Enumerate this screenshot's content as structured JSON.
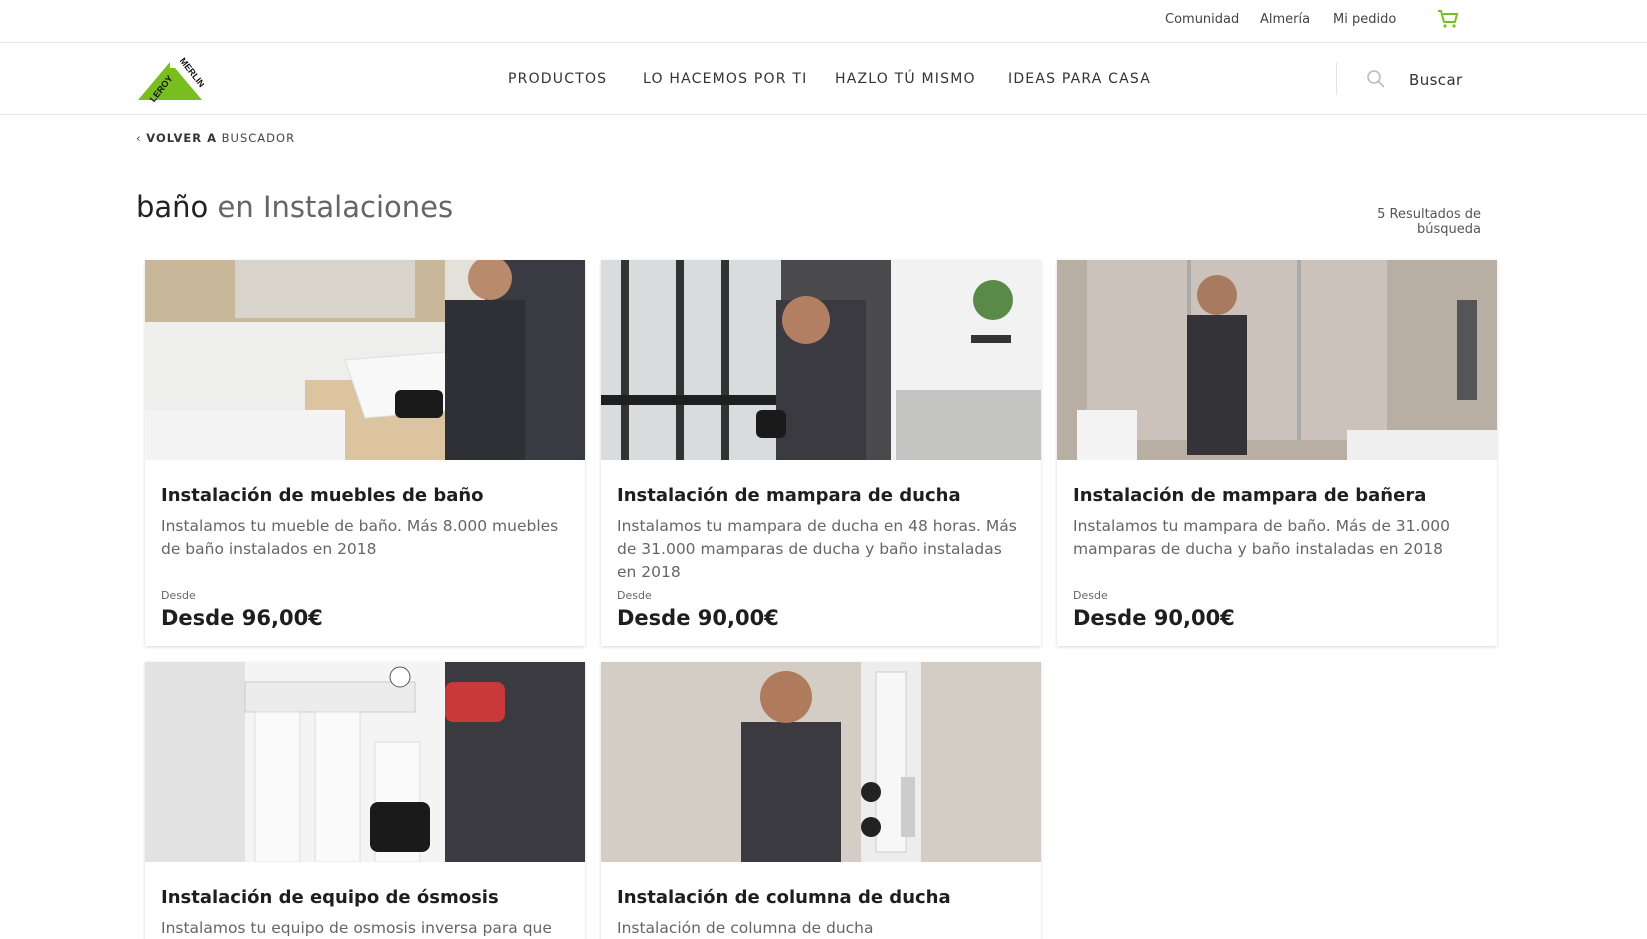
{
  "topbar": {
    "links": [
      "Comunidad",
      "Almería",
      "Mi pedido"
    ]
  },
  "header": {
    "brand": "LEROY MERLIN",
    "nav": [
      "PRODUCTOS",
      "LO HACEMOS POR TI",
      "HAZLO TÚ MISMO",
      "IDEAS PARA CASA"
    ],
    "search_label": "Buscar"
  },
  "back": {
    "bold": "VOLVER A",
    "rest": "BUSCADOR"
  },
  "heading": {
    "query": "baño",
    "connector": "en",
    "category": "Instalaciones"
  },
  "results_count": "5 Resultados de búsqueda",
  "cards": [
    {
      "title": "Instalación de muebles de baño",
      "description": "Instalamos tu mueble de baño. Más 8.000 muebles de baño instalados en 2018",
      "price_label": "Desde",
      "price": "Desde 96,00€"
    },
    {
      "title": "Instalación de mampara de ducha",
      "description": "Instalamos tu mampara de ducha en 48 horas. Más de 31.000 mamparas de ducha y baño instaladas en 2018",
      "price_label": "Desde",
      "price": "Desde 90,00€"
    },
    {
      "title": "Instalación de mampara de bañera",
      "description": "Instalamos tu mampara de baño. Más de 31.000 mamparas de ducha y baño instaladas en 2018",
      "price_label": "Desde",
      "price": "Desde 90,00€"
    },
    {
      "title": "Instalación de equipo de ósmosis",
      "description": "Instalamos tu equipo de osmosis inversa para que",
      "price_label": "",
      "price": ""
    },
    {
      "title": "Instalación de columna de ducha",
      "description": "Instalación de columna de ducha",
      "price_label": "",
      "price": ""
    }
  ],
  "colors": {
    "brand_green": "#78be20",
    "text": "#222222",
    "muted": "#666666"
  },
  "icons": [
    "cart-icon",
    "search-icon",
    "chevron-left-icon",
    "brand-logo"
  ]
}
